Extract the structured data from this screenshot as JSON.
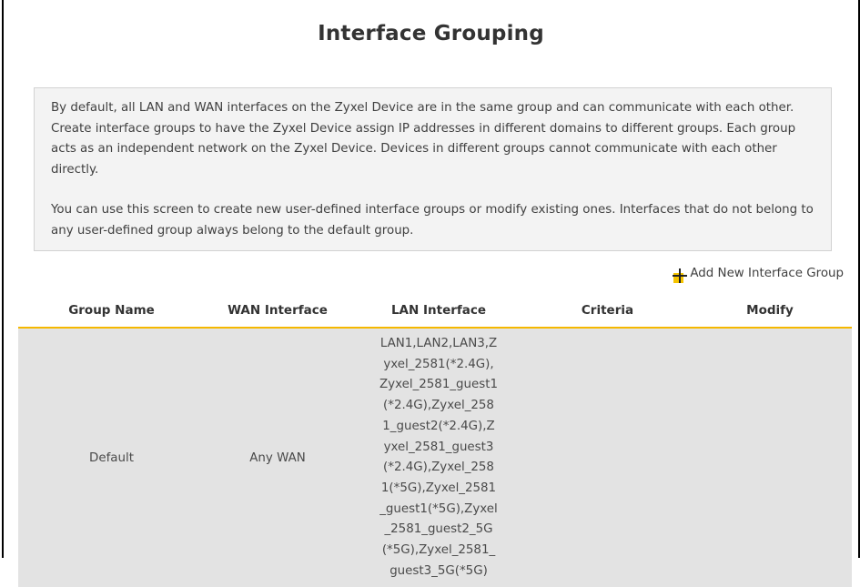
{
  "page": {
    "title": "Interface Grouping"
  },
  "description": {
    "paragraph1": "By default, all LAN and WAN interfaces on the Zyxel Device are in the same group and can communicate with each other. Create interface groups to have the Zyxel Device assign IP addresses in different domains to different groups. Each group acts as an independent network on the Zyxel Device. Devices in different groups cannot communicate with each other directly.",
    "paragraph2": "You can use this screen to create new user-defined interface groups or modify existing ones. Interfaces that do not belong to any user-defined group always belong to the default group."
  },
  "actions": {
    "add_label": "Add New Interface Group",
    "add_icon": "plus-icon",
    "add_icon_color": "#f5c400"
  },
  "table": {
    "columns": [
      "Group Name",
      "WAN Interface",
      "LAN Interface",
      "Criteria",
      "Modify"
    ],
    "rows": [
      {
        "group_name": "Default",
        "wan_interface": "Any WAN",
        "lan_interface": "LAN1,LAN2,LAN3,Zyxel_2581(*2.4G),Zyxel_2581_guest1(*2.4G),Zyxel_2581_guest2(*2.4G),Zyxel_2581_guest3(*2.4G),Zyxel_2581(*5G),Zyxel_2581_guest1(*5G),Zyxel_2581_guest2_5G(*5G),Zyxel_2581_guest3_5G(*5G)",
        "criteria": "",
        "modify": ""
      }
    ],
    "header_underline_color": "#f5b800",
    "row_background": "#e3e3e3"
  }
}
